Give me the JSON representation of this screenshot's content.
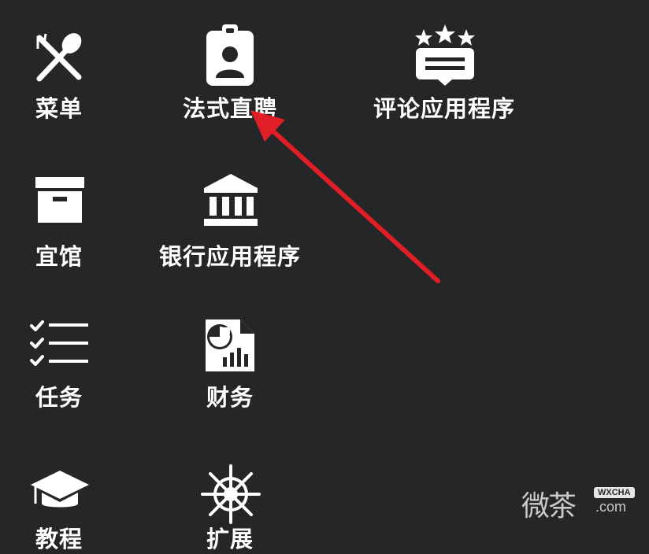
{
  "apps": [
    {
      "id": "menu",
      "label": "菜单",
      "icon": "fork-spoon-icon"
    },
    {
      "id": "recruitment",
      "label": "法式直聘",
      "icon": "id-badge-icon"
    },
    {
      "id": "reviews",
      "label": "评论应用程序",
      "icon": "star-rating-icon"
    },
    {
      "id": "stock",
      "label": "宜馆",
      "icon": "archive-box-icon"
    },
    {
      "id": "bank",
      "label": "银行应用程序",
      "icon": "bank-icon"
    },
    {
      "id": "tasks",
      "label": "任务",
      "icon": "checklist-icon"
    },
    {
      "id": "finance",
      "label": "财务",
      "icon": "finance-report-icon"
    },
    {
      "id": "tutorials",
      "label": "教程",
      "icon": "graduation-cap-icon"
    },
    {
      "id": "expansion",
      "label": "扩展",
      "icon": "ship-wheel-icon"
    }
  ],
  "annotation": {
    "color": "#e01e25"
  },
  "watermark": {
    "text": "微茶",
    "tag": "WXCHA",
    "domain": ".com"
  }
}
